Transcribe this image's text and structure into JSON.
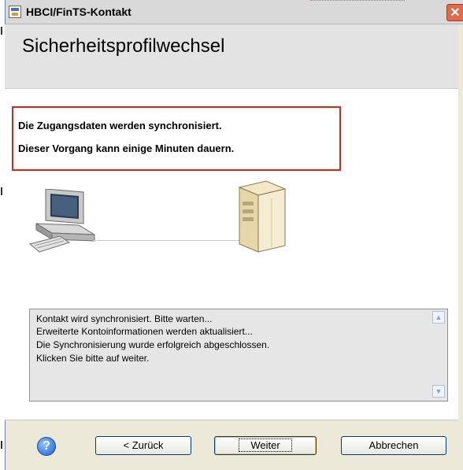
{
  "window": {
    "title": "HBCI/FinTS-Kontakt",
    "close_symbol": "✕"
  },
  "header": {
    "title": "Sicherheitsprofilwechsel"
  },
  "notice": {
    "line1": "Die Zugangsdaten werden synchronisiert.",
    "line2": "Dieser Vorgang kann einige Minuten dauern."
  },
  "log": {
    "lines": [
      "Kontakt wird synchronisiert. Bitte warten...",
      "Erweiterte Kontoinformationen werden aktualisiert...",
      "Die Synchronisierung wurde erfolgreich abgeschlossen.",
      "Klicken Sie bitte auf weiter."
    ]
  },
  "buttons": {
    "help": "?",
    "back": "< Zurück",
    "next": "Weiter",
    "cancel": "Abbrechen"
  },
  "icons": {
    "app": "app-window-icon",
    "computer": "computer-icon",
    "server": "server-icon",
    "help": "help-icon",
    "scroll_up": "scroll-up-icon",
    "scroll_down": "scroll-down-icon"
  },
  "colors": {
    "notice_border": "#e02020",
    "close_button": "#e06a4a",
    "help_button": "#1f5fd0"
  }
}
